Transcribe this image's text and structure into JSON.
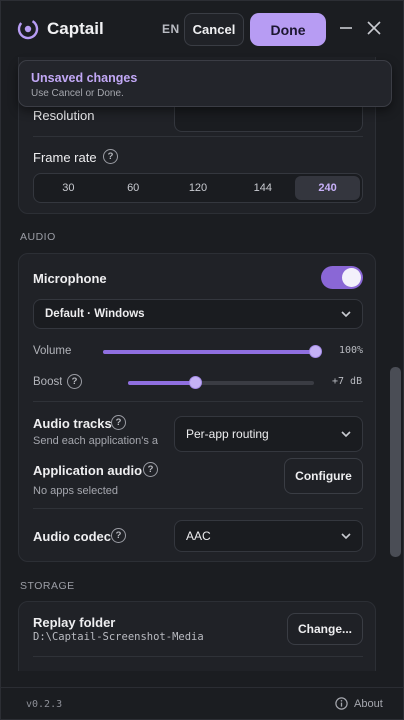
{
  "header": {
    "app_name": "Captail",
    "lang": "EN",
    "cancel_label": "Cancel",
    "done_label": "Done",
    "accent": "#b79cf3"
  },
  "banner": {
    "title": "Unsaved changes",
    "subtitle": "Use Cancel or Done."
  },
  "video": {
    "resolution_label": "Resolution",
    "frame_rate_label": "Frame rate",
    "frame_rates": [
      "30",
      "60",
      "120",
      "144",
      "240"
    ],
    "selected_frame_rate": "240"
  },
  "audio": {
    "section_label": "AUDIO",
    "microphone_label": "Microphone",
    "microphone_enabled": true,
    "device": "Default · Windows",
    "volume_label": "Volume",
    "volume_value": "100%",
    "volume_level": 1.0,
    "boost_label": "Boost",
    "boost_value": "+7 dB",
    "boost_level": 0.36,
    "tracks_label": "Audio tracks",
    "tracks_sub": "Send each application's a",
    "tracks_value": "Per-app routing",
    "app_audio_label": "Application audio",
    "app_audio_sub": "No apps selected",
    "configure_label": "Configure",
    "codec_label": "Audio codec",
    "codec_value": "AAC"
  },
  "storage": {
    "section_label": "STORAGE",
    "replay_folder_label": "Replay folder",
    "replay_folder_path": "D:\\Captail-Screenshot-Media",
    "change_label": "Change..."
  },
  "footer": {
    "version": "v0.2.3",
    "about_label": "About"
  }
}
